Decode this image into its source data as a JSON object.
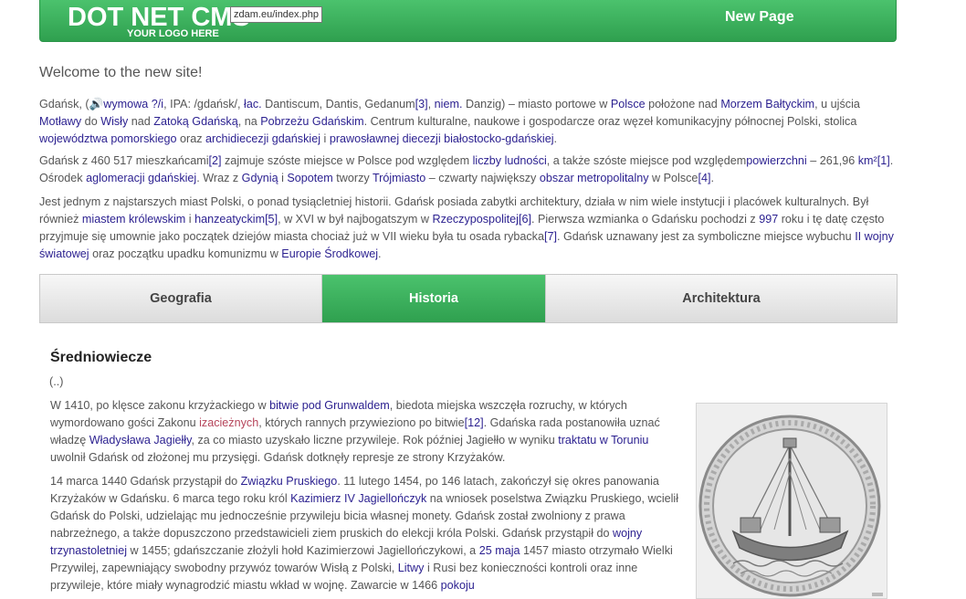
{
  "header": {
    "logo": "DOT NET CMS",
    "logo_sub": "YOUR LOGO HERE",
    "tooltip": "zdam.eu/index.php",
    "new_page": "New Page"
  },
  "welcome": "Welcome to the new site!",
  "p1": [
    {
      "t": "Gdańsk, (🔊"
    },
    {
      "t": "wymowa ?/i",
      "link": true
    },
    {
      "t": ", IPA: /gdańsk/, "
    },
    {
      "t": "łac.",
      "link": true
    },
    {
      "t": " Dantiscum, Dantis, Gedanum"
    },
    {
      "t": "[3]",
      "link": true
    },
    {
      "t": ", "
    },
    {
      "t": "niem.",
      "link": true
    },
    {
      "t": " Danzig) – miasto portowe w "
    },
    {
      "t": "Polsce",
      "link": true
    },
    {
      "t": " położone nad "
    },
    {
      "t": "Morzem Bałtyckim",
      "link": true
    },
    {
      "t": ", u ujścia "
    },
    {
      "t": "Motławy",
      "link": true
    },
    {
      "t": " do "
    },
    {
      "t": "Wisły",
      "link": true
    },
    {
      "t": " nad "
    },
    {
      "t": "Zatoką Gdańską",
      "link": true
    },
    {
      "t": ", na "
    },
    {
      "t": "Pobrzeżu Gdańskim",
      "link": true
    },
    {
      "t": ". Centrum kulturalne, naukowe i gospodarcze oraz węzeł komunikacyjny północnej Polski, stolica "
    },
    {
      "t": "województwa pomorskiego",
      "link": true
    },
    {
      "t": " oraz "
    },
    {
      "t": "archidiecezji gdańskiej",
      "link": true
    },
    {
      "t": " i "
    },
    {
      "t": "prawosławnej diecezji białostocko-gdańskiej",
      "link": true
    },
    {
      "t": "."
    }
  ],
  "p2": [
    {
      "t": "Gdańsk z 460 517 mieszkańcami"
    },
    {
      "t": "[2]",
      "link": true
    },
    {
      "t": " zajmuje szóste miejsce w Polsce pod względem "
    },
    {
      "t": "liczby ludności",
      "link": true
    },
    {
      "t": ", a także szóste miejsce pod względem"
    },
    {
      "t": "powierzchni",
      "link": true
    },
    {
      "t": " – 261,96 "
    },
    {
      "t": "km²",
      "link": true
    },
    {
      "t": "[1]",
      "link": true
    },
    {
      "t": ". Ośrodek "
    },
    {
      "t": "aglomeracji gdańskiej",
      "link": true
    },
    {
      "t": ". Wraz z "
    },
    {
      "t": "Gdynią",
      "link": true
    },
    {
      "t": " i "
    },
    {
      "t": "Sopotem",
      "link": true
    },
    {
      "t": " tworzy "
    },
    {
      "t": "Trójmiasto",
      "link": true
    },
    {
      "t": " – czwarty największy "
    },
    {
      "t": "obszar metropolitalny",
      "link": true
    },
    {
      "t": " w Polsce"
    },
    {
      "t": "[4]",
      "link": true
    },
    {
      "t": "."
    }
  ],
  "p3": [
    {
      "t": "Jest jednym z najstarszych miast Polski, o ponad tysiącletniej historii. Gdańsk posiada zabytki architektury, działa w nim wiele instytucji i placówek kulturalnych. Był również "
    },
    {
      "t": "miastem królewskim",
      "link": true
    },
    {
      "t": " i "
    },
    {
      "t": "hanzeatyckim",
      "link": true
    },
    {
      "t": "[5]",
      "link": true
    },
    {
      "t": ", w XVI w był najbogatszym w "
    },
    {
      "t": "Rzeczypospolitej",
      "link": true
    },
    {
      "t": "[6]",
      "link": true
    },
    {
      "t": ". Pierwsza wzmianka o Gdańsku pochodzi z "
    },
    {
      "t": "997",
      "link": true
    },
    {
      "t": " roku i tę datę często przyjmuje się umownie jako początek dziejów miasta chociaż już w VII wieku była tu osada rybacka"
    },
    {
      "t": "[7]",
      "link": true
    },
    {
      "t": ". Gdańsk uznawany jest za symboliczne miejsce wybuchu "
    },
    {
      "t": "II wojny światowej",
      "link": true
    },
    {
      "t": " oraz początku upadku komunizmu w "
    },
    {
      "t": "Europie Środkowej",
      "link": true
    },
    {
      "t": "."
    }
  ],
  "tabs": [
    "Geografia",
    "Historia",
    "Architektura"
  ],
  "active_tab": "Historia",
  "section": {
    "title": "Średniowiecze",
    "ellipsis": "(..)",
    "sp1": [
      {
        "t": "W 1410, po klęsce zakonu krzyżackiego w "
      },
      {
        "t": "bitwie pod Grunwaldem",
        "link": true
      },
      {
        "t": ", biedota miejska wszczęła rozruchy, w których wymordowano gości Zakonu "
      },
      {
        "t": "izacieżnych",
        "link": true,
        "red": true
      },
      {
        "t": ", których rannych przywieziono po bitwie"
      },
      {
        "t": "[12]",
        "link": true
      },
      {
        "t": ". Gdańska rada postanowiła uznać władzę "
      },
      {
        "t": "Władysława Jagiełły",
        "link": true
      },
      {
        "t": ", za co miasto uzyskało liczne przywileje. Rok później Jagiełło w wyniku "
      },
      {
        "t": "traktatu w Toruniu",
        "link": true
      },
      {
        "t": " uwolnił Gdańsk od złożonej mu przysięgi. Gdańsk dotknęły represje ze strony Krzyżaków."
      }
    ],
    "sp2": [
      {
        "t": "14 marca 1440 Gdańsk przystąpił do "
      },
      {
        "t": "Związku Pruskiego",
        "link": true
      },
      {
        "t": ". 11 lutego 1454, po 146 latach, zakończył się okres panowania Krzyżaków w Gdańsku. 6 marca tego roku król "
      },
      {
        "t": "Kazimierz IV Jagiellończyk",
        "link": true
      },
      {
        "t": " na wniosek poselstwa Związku Pruskiego, wcielił Gdańsk do Polski, udzielając mu jednocześnie przywileju bicia własnej monety. Gdańsk został zwolniony z prawa nabrzeżnego, a także dopuszczono przedstawicieli ziem pruskich do elekcji króla Polski. Gdańsk przystąpił do "
      },
      {
        "t": "wojny trzynastoletniej",
        "link": true
      },
      {
        "t": " w 1455; gdańszczanie złożyli hołd Kazimierzowi Jagiellończykowi, a "
      },
      {
        "t": "25 maja",
        "link": true
      },
      {
        "t": " 1457 miasto otrzymało Wielki Przywilej, zapewniający swobodny przywóz towarów Wisłą z Polski, "
      },
      {
        "t": "Litwy",
        "link": true
      },
      {
        "t": " i Rusi bez konieczności kontroli oraz inne przywileje, które miały wynagrodzić miastu wkład w wojnę. Zawarcie w 1466 "
      },
      {
        "t": "pokoju",
        "link": true
      }
    ]
  },
  "image": {
    "icon": "seal-image"
  }
}
